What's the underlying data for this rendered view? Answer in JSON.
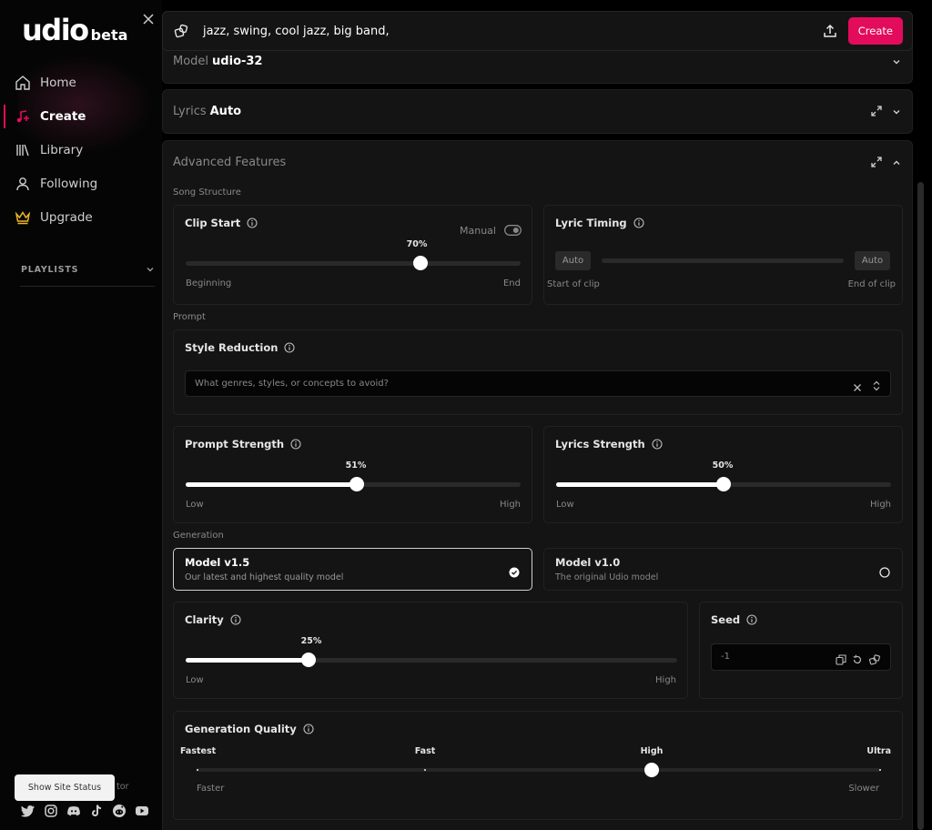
{
  "sidebar": {
    "logo_text": "udio",
    "logo_suffix": "beta",
    "nav": [
      {
        "label": "Home"
      },
      {
        "label": "Create"
      },
      {
        "label": "Library"
      },
      {
        "label": "Following"
      },
      {
        "label": "Upgrade"
      }
    ],
    "playlists_label": "PLAYLISTS",
    "behind_status_text": "tor",
    "status_button": "Show Site Status",
    "socials": [
      "twitter-icon",
      "instagram-icon",
      "discord-icon",
      "tiktok-icon",
      "reddit-icon",
      "youtube-icon"
    ]
  },
  "prompt": {
    "text": "jazz, swing, cool jazz, big band,",
    "create_label": "Create"
  },
  "model_panel": {
    "label": "Model",
    "value": "udio-32"
  },
  "lyrics_panel": {
    "label": "Lyrics",
    "value": "Auto"
  },
  "advanced": {
    "title": "Advanced Features",
    "song_structure_label": "Song Structure",
    "clip_start": {
      "title": "Clip Start",
      "manual_label": "Manual",
      "value_label": "70%",
      "value": 0.7,
      "min_label": "Beginning",
      "max_label": "End"
    },
    "lyric_timing": {
      "title": "Lyric Timing",
      "left_tag": "Auto",
      "right_tag": "Auto",
      "min_label": "Start of clip",
      "max_label": "End of clip"
    },
    "prompt_label": "Prompt",
    "style_reduction": {
      "title": "Style Reduction",
      "placeholder": "What genres, styles, or concepts to avoid?"
    },
    "prompt_strength": {
      "title": "Prompt Strength",
      "value_label": "51%",
      "value": 0.51,
      "min_label": "Low",
      "max_label": "High"
    },
    "lyrics_strength": {
      "title": "Lyrics Strength",
      "value_label": "50%",
      "value": 0.5,
      "min_label": "Low",
      "max_label": "High"
    },
    "generation_label": "Generation",
    "models": [
      {
        "name": "Model v1.5",
        "desc": "Our latest and highest quality model",
        "selected": true
      },
      {
        "name": "Model v1.0",
        "desc": "The original Udio model",
        "selected": false
      }
    ],
    "clarity": {
      "title": "Clarity",
      "value_label": "25%",
      "value": 0.25,
      "min_label": "Low",
      "max_label": "High"
    },
    "seed": {
      "title": "Seed",
      "value": "-1"
    },
    "generation_quality": {
      "title": "Generation Quality",
      "ticks": [
        "Fastest",
        "Fast",
        "High",
        "Ultra"
      ],
      "selected_index": 2,
      "min_label": "Faster",
      "max_label": "Slower"
    }
  },
  "colors": {
    "accent": "#e30b5c",
    "upgrade": "#f0b429"
  }
}
